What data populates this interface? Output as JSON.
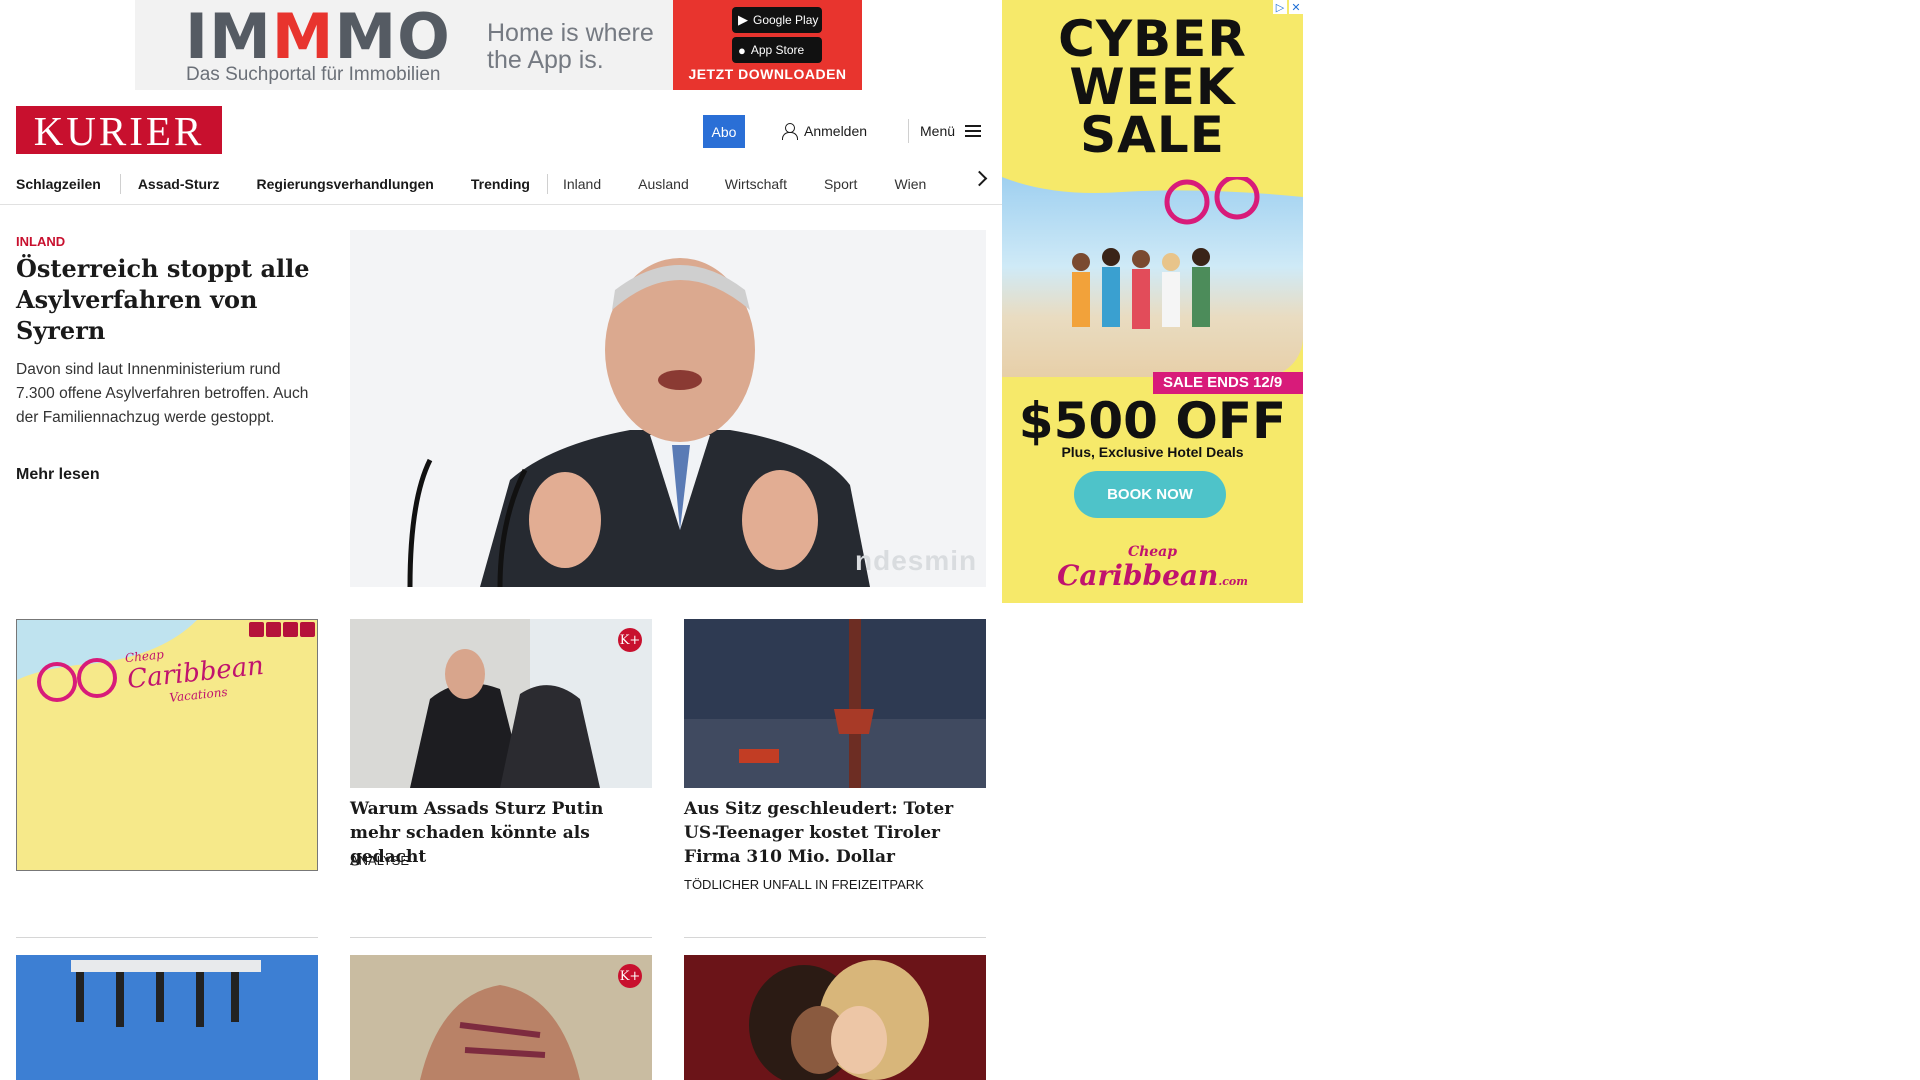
{
  "top_ad": {
    "brand_a": "IM",
    "brand_b": "M",
    "brand_c": "MO",
    "sub": "Das Suchportal für Immobilien",
    "slogan_1": "Home is where",
    "slogan_2": "the App is.",
    "badge_1": "Google Play",
    "badge_2": "App Store",
    "cta": "JETZT DOWNLOADEN",
    "accent": "#e8342e"
  },
  "header": {
    "logo": "KURIER",
    "abo": "Abo",
    "login": "Anmelden",
    "menu": "Menü",
    "brand_color": "#c8102e"
  },
  "nav": {
    "items": [
      "Schlagzeilen",
      "Assad-Sturz",
      "Regierungsverhandlungen",
      "Trending",
      "Inland",
      "Ausland",
      "Wirtschaft",
      "Sport",
      "Wien"
    ]
  },
  "lead": {
    "kicker": "INLAND",
    "title": "Österreich stoppt alle Asylverfahren von Syrern",
    "teaser": "Davon sind laut Innenministerium rund 7.300 offene Asylverfahren betroffen. Auch der Familiennachzug werde gestoppt.",
    "more": "Mehr lesen",
    "image_watermark": "ndesmin"
  },
  "cards": [
    {
      "title": "Warum Assads Sturz Putin mehr schaden könnte als gedacht",
      "label": "ANALYSE",
      "premium": "K+"
    },
    {
      "title": "Aus Sitz geschleudert: Toter US-Teenager kostet Tiroler Firma 310 Mio. Dollar",
      "label": "TÖDLICHER UNFALL IN FREIZEITPARK"
    }
  ],
  "row2": {
    "premium": "K+"
  },
  "small_ad": {
    "brand": "Caribbean",
    "top": "Cheap",
    "bottom": "Vacations"
  },
  "side_ad": {
    "line1": "CYBER",
    "line2": "WEEK",
    "line3": "SALE",
    "sale_ends": "SALE ENDS 12/9",
    "off": "$500 OFF",
    "plus": "Plus, Exclusive Hotel Deals",
    "book": "BOOK NOW",
    "logo_top": "Cheap",
    "logo": "Caribbean",
    "logo_suffix": ".com",
    "bg": "#f6e96a"
  }
}
